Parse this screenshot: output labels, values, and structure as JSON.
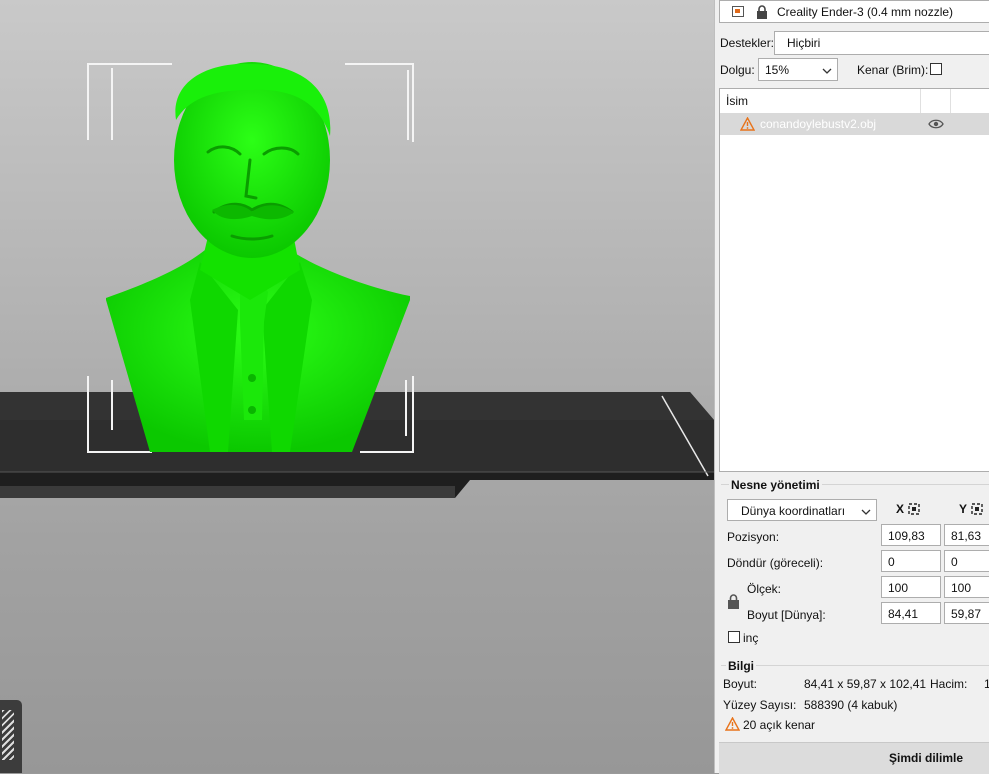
{
  "printer": {
    "name": "Creality Ender-3 (0.4 mm nozzle)"
  },
  "supports": {
    "label": "Destekler:",
    "value": "Hiçbiri"
  },
  "infill": {
    "label": "Dolgu:",
    "value": "15%",
    "brim_label": "Kenar (Brim):",
    "brim_checked": false
  },
  "object_list": {
    "header_name": "İsim",
    "items": [
      {
        "name": "conandoylebustv2.obj",
        "warning": true,
        "visible": true
      }
    ]
  },
  "object_manipulation": {
    "title": "Nesne yönetimi",
    "coord_system": "Dünya koordinatları",
    "axis_x": "X",
    "axis_y": "Y",
    "rows": [
      {
        "label": "Pozisyon:",
        "x": "109,83",
        "y": "81,63"
      },
      {
        "label": "Döndür (göreceli):",
        "x": "0",
        "y": "0"
      },
      {
        "label": "Ölçek:",
        "x": "100",
        "y": "100"
      },
      {
        "label": "Boyut [Dünya]:",
        "x": "84,41",
        "y": "59,87"
      }
    ],
    "inches_label": "inç",
    "inches_checked": false
  },
  "info": {
    "title": "Bilgi",
    "size_label": "Boyut:",
    "size_value": "84,41 x 59,87 x 102,41",
    "volume_label": "Hacim:",
    "volume_value_partial": "1",
    "facets_label": "Yüzey Sayısı:",
    "facets_value": "588390 (4 kabuk)",
    "warning_text": "20 açık kenar"
  },
  "slice_button": {
    "label": "Şimdi dilimle"
  },
  "colors": {
    "model": "#11e800",
    "warning": "#e8731a",
    "bed": "#2e2e2e"
  }
}
